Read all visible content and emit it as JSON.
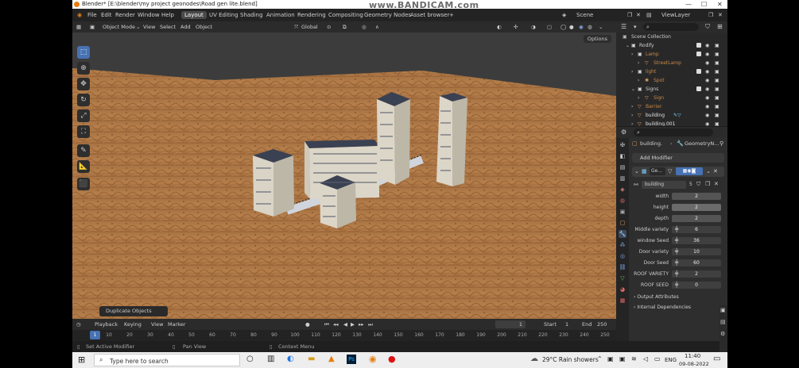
{
  "window": {
    "title": "Blender* [E:\\blender\\my project geonodes\\Road gen lite.blend]",
    "watermark": "www.BANDICAM.com"
  },
  "menu": {
    "items": [
      "File",
      "Edit",
      "Render",
      "Window",
      "Help"
    ],
    "workspaces": [
      "Layout",
      "UV Editing",
      "Shading",
      "Animation",
      "Rendering",
      "Compositing",
      "Geometry Nodes",
      "Asset browser"
    ],
    "add_tab": "+",
    "scene_label": "Scene",
    "viewlayer_label": "ViewLayer"
  },
  "viewport_header": {
    "mode": "Object Mode",
    "items": [
      "View",
      "Select",
      "Add",
      "Object"
    ],
    "transform": "Global",
    "options": "Options"
  },
  "viewport": {
    "last_operator": "Duplicate Objects"
  },
  "outliner": {
    "rows": [
      {
        "label": "Scene Collection",
        "indent": 0,
        "color": "#d0d0d0"
      },
      {
        "label": "Rodify",
        "indent": 1,
        "color": "#d0d0d0"
      },
      {
        "label": "Lamp",
        "indent": 2,
        "color": "#c8894a"
      },
      {
        "label": "StreetLamp",
        "indent": 3,
        "color": "#c8894a"
      },
      {
        "label": "light",
        "indent": 2,
        "color": "#c8894a"
      },
      {
        "label": "Spot",
        "indent": 3,
        "color": "#c8894a"
      },
      {
        "label": "Signs",
        "indent": 2,
        "color": "#d0d0d0"
      },
      {
        "label": "Sign",
        "indent": 3,
        "color": "#c8894a"
      },
      {
        "label": "Barrier",
        "indent": 2,
        "color": "#c8894a"
      },
      {
        "label": "building",
        "indent": 2,
        "color": "#e6e6e6"
      },
      {
        "label": "building.001",
        "indent": 2,
        "color": "#e6e6e6"
      }
    ]
  },
  "properties": {
    "breadcrumb_object": "building.",
    "breadcrumb_modifier": "GeometryN...",
    "add_modifier": "Add Modifier",
    "modifier_name": "Ge...",
    "node_group": "building",
    "node_users": "5",
    "fields": [
      {
        "label": "width",
        "value": "2"
      },
      {
        "label": "height",
        "value": "2"
      },
      {
        "label": "depth",
        "value": "2"
      },
      {
        "label": "Middle variety",
        "value": "6"
      },
      {
        "label": "window Seed",
        "value": "36"
      },
      {
        "label": "Door variety",
        "value": "10"
      },
      {
        "label": "Door Seed",
        "value": "60"
      },
      {
        "label": "ROOF VARIETY",
        "value": "2"
      },
      {
        "label": "ROOF SEED",
        "value": "0"
      }
    ],
    "output_attributes": "Output Attributes",
    "internal_dependencies": "Internal Dependencies"
  },
  "timeline": {
    "menus": [
      "Playback",
      "Keying",
      "View",
      "Marker"
    ],
    "current_frame": "1",
    "start_label": "Start",
    "start": "1",
    "end_label": "End",
    "end": "250",
    "ticks": [
      "10",
      "20",
      "30",
      "40",
      "50",
      "60",
      "70",
      "80",
      "90",
      "100",
      "110",
      "120",
      "130",
      "140",
      "150",
      "160",
      "170",
      "180",
      "190",
      "200",
      "210",
      "220",
      "230",
      "240",
      "250"
    ],
    "cursor": "1"
  },
  "status": {
    "left": "Set Active Modifier",
    "mid": "Pan View",
    "right": "Context Menu"
  },
  "taskbar": {
    "search_placeholder": "Type here to search",
    "weather": "29°C  Rain showers",
    "lang": "ENG",
    "time": "11:40",
    "date": "09-08-2022"
  }
}
